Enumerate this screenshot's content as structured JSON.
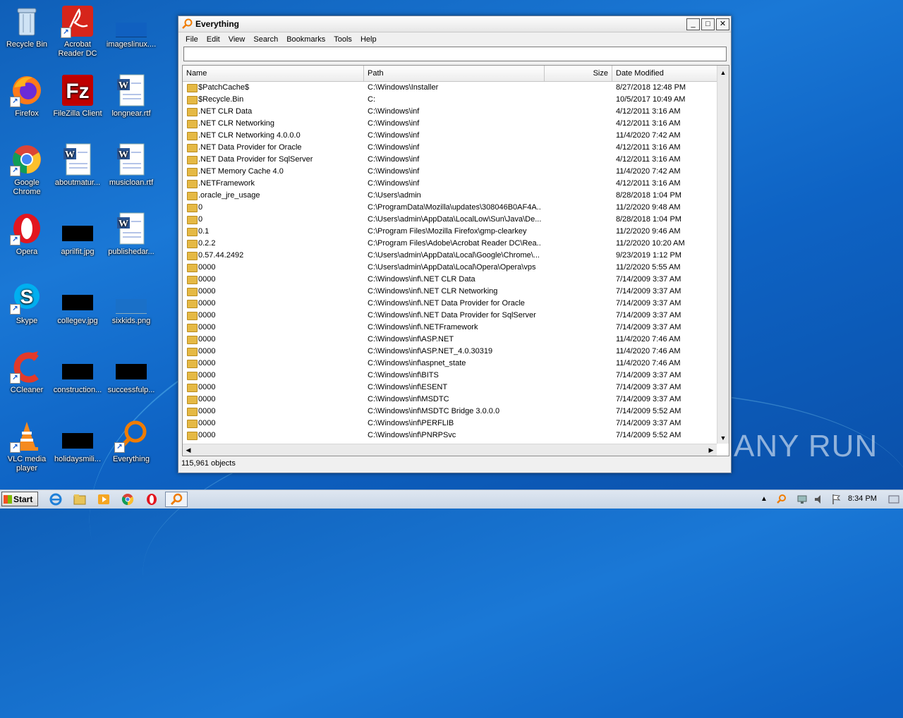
{
  "desktop": {
    "icons": [
      {
        "label": "Recycle Bin"
      },
      {
        "label": "Acrobat Reader DC"
      },
      {
        "label": "imageslinux...."
      },
      {
        "label": "Firefox"
      },
      {
        "label": "FileZilla Client"
      },
      {
        "label": "longnear.rtf"
      },
      {
        "label": "Google Chrome"
      },
      {
        "label": "aboutmatur..."
      },
      {
        "label": "musicloan.rtf"
      },
      {
        "label": "Opera"
      },
      {
        "label": "aprilfit.jpg"
      },
      {
        "label": "publishedar..."
      },
      {
        "label": "Skype"
      },
      {
        "label": "collegev.jpg"
      },
      {
        "label": "sixkids.png"
      },
      {
        "label": "CCleaner"
      },
      {
        "label": "construction..."
      },
      {
        "label": "successfulp..."
      },
      {
        "label": "VLC media player"
      },
      {
        "label": "holidaysmili..."
      },
      {
        "label": "Everything"
      }
    ]
  },
  "window": {
    "title": "Everything",
    "menu": [
      "File",
      "Edit",
      "View",
      "Search",
      "Bookmarks",
      "Tools",
      "Help"
    ],
    "search_value": "",
    "columns": [
      "Name",
      "Path",
      "Size",
      "Date Modified"
    ],
    "rows": [
      {
        "name": "$PatchCache$",
        "path": "C:\\Windows\\Installer",
        "size": "",
        "date": "8/27/2018 12:48 PM"
      },
      {
        "name": "$Recycle.Bin",
        "path": "C:",
        "size": "",
        "date": "10/5/2017 10:49 AM"
      },
      {
        "name": ".NET CLR Data",
        "path": "C:\\Windows\\inf",
        "size": "",
        "date": "4/12/2011 3:16 AM"
      },
      {
        "name": ".NET CLR Networking",
        "path": "C:\\Windows\\inf",
        "size": "",
        "date": "4/12/2011 3:16 AM"
      },
      {
        "name": ".NET CLR Networking 4.0.0.0",
        "path": "C:\\Windows\\inf",
        "size": "",
        "date": "11/4/2020 7:42 AM"
      },
      {
        "name": ".NET Data Provider for Oracle",
        "path": "C:\\Windows\\inf",
        "size": "",
        "date": "4/12/2011 3:16 AM"
      },
      {
        "name": ".NET Data Provider for SqlServer",
        "path": "C:\\Windows\\inf",
        "size": "",
        "date": "4/12/2011 3:16 AM"
      },
      {
        "name": ".NET Memory Cache 4.0",
        "path": "C:\\Windows\\inf",
        "size": "",
        "date": "11/4/2020 7:42 AM"
      },
      {
        "name": ".NETFramework",
        "path": "C:\\Windows\\inf",
        "size": "",
        "date": "4/12/2011 3:16 AM"
      },
      {
        "name": ".oracle_jre_usage",
        "path": "C:\\Users\\admin",
        "size": "",
        "date": "8/28/2018 1:04 PM"
      },
      {
        "name": "0",
        "path": "C:\\ProgramData\\Mozilla\\updates\\308046B0AF4A...",
        "size": "",
        "date": "11/2/2020 9:48 AM"
      },
      {
        "name": "0",
        "path": "C:\\Users\\admin\\AppData\\LocalLow\\Sun\\Java\\De...",
        "size": "",
        "date": "8/28/2018 1:04 PM"
      },
      {
        "name": "0.1",
        "path": "C:\\Program Files\\Mozilla Firefox\\gmp-clearkey",
        "size": "",
        "date": "11/2/2020 9:46 AM"
      },
      {
        "name": "0.2.2",
        "path": "C:\\Program Files\\Adobe\\Acrobat Reader DC\\Rea...",
        "size": "",
        "date": "11/2/2020 10:20 AM"
      },
      {
        "name": "0.57.44.2492",
        "path": "C:\\Users\\admin\\AppData\\Local\\Google\\Chrome\\...",
        "size": "",
        "date": "9/23/2019 1:12 PM"
      },
      {
        "name": "0000",
        "path": "C:\\Users\\admin\\AppData\\Local\\Opera\\Opera\\vps",
        "size": "",
        "date": "11/2/2020 5:55 AM"
      },
      {
        "name": "0000",
        "path": "C:\\Windows\\inf\\.NET CLR Data",
        "size": "",
        "date": "7/14/2009 3:37 AM"
      },
      {
        "name": "0000",
        "path": "C:\\Windows\\inf\\.NET CLR Networking",
        "size": "",
        "date": "7/14/2009 3:37 AM"
      },
      {
        "name": "0000",
        "path": "C:\\Windows\\inf\\.NET Data Provider for Oracle",
        "size": "",
        "date": "7/14/2009 3:37 AM"
      },
      {
        "name": "0000",
        "path": "C:\\Windows\\inf\\.NET Data Provider for SqlServer",
        "size": "",
        "date": "7/14/2009 3:37 AM"
      },
      {
        "name": "0000",
        "path": "C:\\Windows\\inf\\.NETFramework",
        "size": "",
        "date": "7/14/2009 3:37 AM"
      },
      {
        "name": "0000",
        "path": "C:\\Windows\\inf\\ASP.NET",
        "size": "",
        "date": "11/4/2020 7:46 AM"
      },
      {
        "name": "0000",
        "path": "C:\\Windows\\inf\\ASP.NET_4.0.30319",
        "size": "",
        "date": "11/4/2020 7:46 AM"
      },
      {
        "name": "0000",
        "path": "C:\\Windows\\inf\\aspnet_state",
        "size": "",
        "date": "11/4/2020 7:46 AM"
      },
      {
        "name": "0000",
        "path": "C:\\Windows\\inf\\BITS",
        "size": "",
        "date": "7/14/2009 3:37 AM"
      },
      {
        "name": "0000",
        "path": "C:\\Windows\\inf\\ESENT",
        "size": "",
        "date": "7/14/2009 3:37 AM"
      },
      {
        "name": "0000",
        "path": "C:\\Windows\\inf\\MSDTC",
        "size": "",
        "date": "7/14/2009 3:37 AM"
      },
      {
        "name": "0000",
        "path": "C:\\Windows\\inf\\MSDTC Bridge 3.0.0.0",
        "size": "",
        "date": "7/14/2009 5:52 AM"
      },
      {
        "name": "0000",
        "path": "C:\\Windows\\inf\\PERFLIB",
        "size": "",
        "date": "7/14/2009 3:37 AM"
      },
      {
        "name": "0000",
        "path": "C:\\Windows\\inf\\PNRPSvc",
        "size": "",
        "date": "7/14/2009 5:52 AM"
      }
    ],
    "status": "115,961 objects"
  },
  "taskbar": {
    "start_label": "Start",
    "clock": "8:34 PM"
  },
  "watermark": "ANY RUN"
}
